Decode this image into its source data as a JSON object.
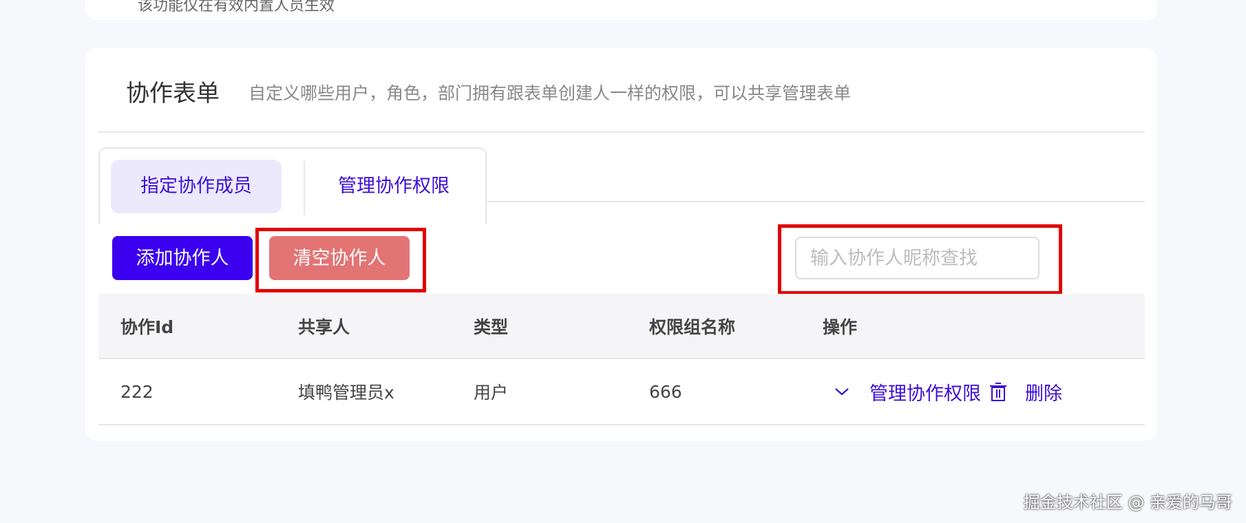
{
  "top_card": {
    "clipped_text": "该功能仅在有效内置人员生效"
  },
  "form_card": {
    "title": "协作表单",
    "description": "自定义哪些用户，角色，部门拥有跟表单创建人一样的权限，可以共享管理表单"
  },
  "tabs": [
    {
      "label": "指定协作成员",
      "active": true
    },
    {
      "label": "管理协作权限",
      "active": false
    }
  ],
  "toolbar": {
    "add_label": "添加协作人",
    "clear_label": "清空协作人",
    "search_placeholder": "输入协作人昵称查找",
    "search_value": ""
  },
  "table": {
    "headers": [
      "协作Id",
      "共享人",
      "类型",
      "权限组名称",
      "操作"
    ],
    "rows": [
      {
        "id": "222",
        "sharer": "填鸭管理员x",
        "type": "用户",
        "group_name": "666",
        "action_manage": "管理协作权限",
        "action_delete": "删除"
      }
    ]
  },
  "watermark": "掘金技术社区 @ 亲爱的马哥",
  "colors": {
    "primary": "#3a00ef",
    "danger_button": "#e27474",
    "highlight_box": "#e30000",
    "tab_active_bg": "#ece9fd",
    "link": "#3a0fd6"
  },
  "icons": [
    "chevron-down-icon",
    "trash-icon"
  ]
}
